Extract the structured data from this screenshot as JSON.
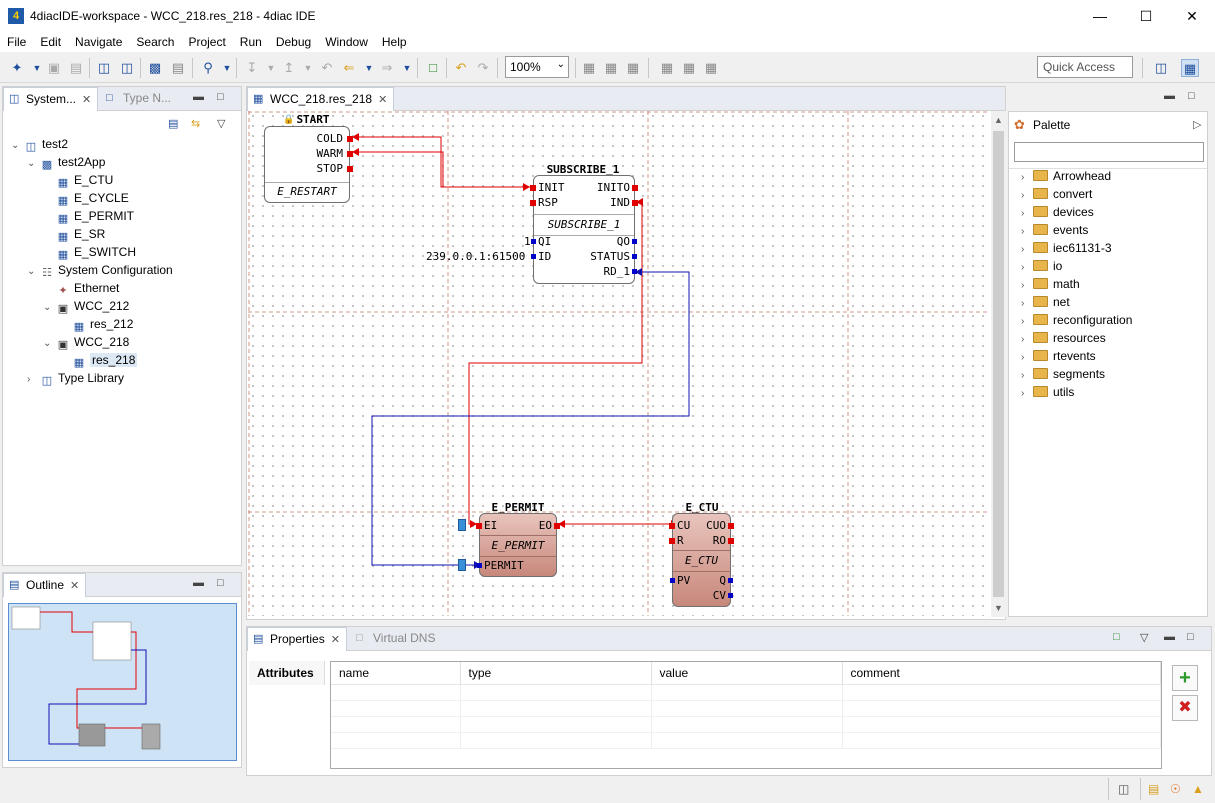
{
  "window": {
    "title": "4diacIDE-workspace - WCC_218.res_218 - 4diac IDE",
    "app_icon": "4diac-logo-icon"
  },
  "menu": [
    "File",
    "Edit",
    "Navigate",
    "Search",
    "Project",
    "Run",
    "Debug",
    "Window",
    "Help"
  ],
  "toolbar": {
    "zoom": "100%",
    "quick_access": "Quick Access"
  },
  "left_panel": {
    "tabs": [
      {
        "label": "System...",
        "icon": "system-explorer-icon"
      },
      {
        "label": "Type N...",
        "icon": "type-navigator-icon"
      }
    ],
    "tree": [
      {
        "label": "test2",
        "icon": "system-icon",
        "expanded": true
      },
      {
        "label": "test2App",
        "icon": "application-icon",
        "expanded": true
      },
      {
        "label": "E_CTU",
        "icon": "fb-icon"
      },
      {
        "label": "E_CYCLE",
        "icon": "fb-icon"
      },
      {
        "label": "E_PERMIT",
        "icon": "fb-icon"
      },
      {
        "label": "E_SR",
        "icon": "fb-icon"
      },
      {
        "label": "E_SWITCH",
        "icon": "fb-icon"
      },
      {
        "label": "System Configuration",
        "icon": "system-configuration-icon",
        "expanded": true
      },
      {
        "label": "Ethernet",
        "icon": "segment-icon"
      },
      {
        "label": "WCC_212",
        "icon": "device-icon",
        "expanded": true
      },
      {
        "label": "res_212",
        "icon": "resource-icon"
      },
      {
        "label": "WCC_218",
        "icon": "device-icon",
        "expanded": true
      },
      {
        "label": "res_218",
        "icon": "resource-icon",
        "selected": true
      },
      {
        "label": "Type Library",
        "icon": "type-library-icon",
        "expanded": false
      }
    ]
  },
  "outline": {
    "tab": "Outline"
  },
  "editor": {
    "tab": "WCC_218.res_218",
    "blocks": {
      "start": {
        "name": "START",
        "type": "E_RESTART",
        "outputs": [
          "COLD",
          "WARM",
          "STOP"
        ]
      },
      "subscribe": {
        "name": "SUBSCRIBE_1",
        "type": "SUBSCRIBE_1",
        "event_in": [
          "INIT",
          "RSP"
        ],
        "event_out": [
          "INITO",
          "IND"
        ],
        "data_in": [
          "QI",
          "ID"
        ],
        "data_out": [
          "QO",
          "STATUS",
          "RD_1"
        ],
        "qi_value": "1",
        "id_value": "239.0.0.1:61500"
      },
      "permit": {
        "name": "E_PERMIT",
        "type": "E_PERMIT",
        "event_in": [
          "EI"
        ],
        "event_out": [
          "EO"
        ],
        "data_in": [
          "PERMIT"
        ]
      },
      "ctu": {
        "name": "E_CTU",
        "type": "E_CTU",
        "event_in": [
          "CU",
          "R"
        ],
        "event_out": [
          "CUO",
          "RO"
        ],
        "data_in": [
          "PV"
        ],
        "data_out": [
          "Q",
          "CV"
        ]
      }
    }
  },
  "palette": {
    "title": "Palette",
    "items": [
      "Arrowhead",
      "convert",
      "devices",
      "events",
      "iec61131-3",
      "io",
      "math",
      "net",
      "reconfiguration",
      "resources",
      "rtevents",
      "segments",
      "utils"
    ]
  },
  "properties": {
    "tabs": [
      {
        "label": "Properties",
        "icon": "properties-icon"
      },
      {
        "label": "Virtual DNS",
        "icon": "virtual-dns-icon"
      }
    ],
    "section": "Attributes",
    "columns": [
      "name",
      "type",
      "value",
      "comment"
    ]
  },
  "colors": {
    "event_connection": "#e00000",
    "data_connection": "#1010b0",
    "fb_fill_pink": "#d9a9a0",
    "fb_header_blue": "#dde8f5"
  }
}
